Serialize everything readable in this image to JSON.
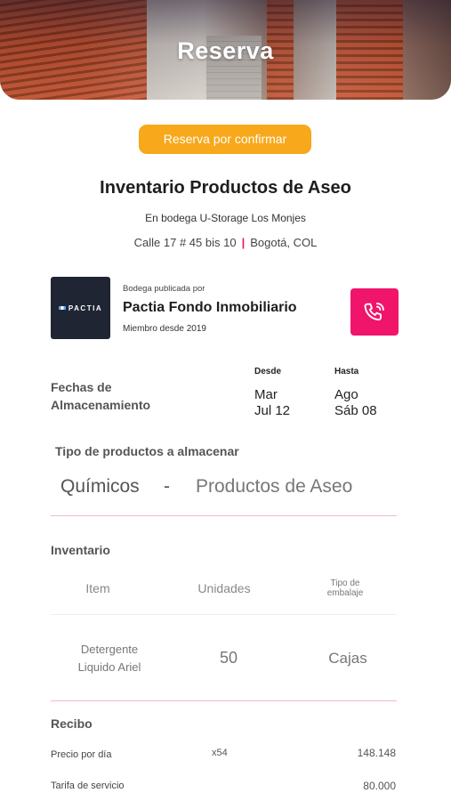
{
  "header": {
    "title": "Reserva"
  },
  "status": {
    "label": "Reserva por confirmar",
    "color": "#f7a81b"
  },
  "product": {
    "title": "Inventario Productos de Aseo",
    "location_prefix": "En bodega",
    "warehouse": "U-Storage Los Monjes",
    "address": "Calle 17 # 45 bis 10",
    "city": "Bogotá, COL"
  },
  "owner": {
    "caption": "Bodega publicada por",
    "name": "Pactia Fondo Inmobiliario",
    "since": "Miembro desde 2019",
    "logo_text": "PACTIA",
    "call_icon": "phone-icon",
    "accent": "#f0156b"
  },
  "dates": {
    "label_line1": "Fechas de",
    "label_line2": "Almacenamiento",
    "from_label": "Desde",
    "from_day": "Mar",
    "from_date": "Jul 12",
    "to_label": "Hasta",
    "to_day": "Ago",
    "to_date": "Sáb 08"
  },
  "product_type": {
    "label": "Tipo de productos a almacenar",
    "category": "Químicos",
    "separator": "-",
    "type": "Productos de Aseo"
  },
  "inventory": {
    "label": "Inventario",
    "headers": {
      "item": "Item",
      "units": "Unidades",
      "packaging_line1": "Tipo de",
      "packaging_line2": "embalaje"
    },
    "rows": [
      {
        "item_line1": "Detergente",
        "item_line2": "Liquido Ariel",
        "units": "50",
        "packaging": "Cajas"
      }
    ]
  },
  "receipt": {
    "label": "Recibo",
    "lines": [
      {
        "name": "Precio por día",
        "qty": "x54",
        "amount": "148.148"
      },
      {
        "name": "Tarifa de servicio",
        "qty": "",
        "amount": "80.000"
      }
    ]
  }
}
